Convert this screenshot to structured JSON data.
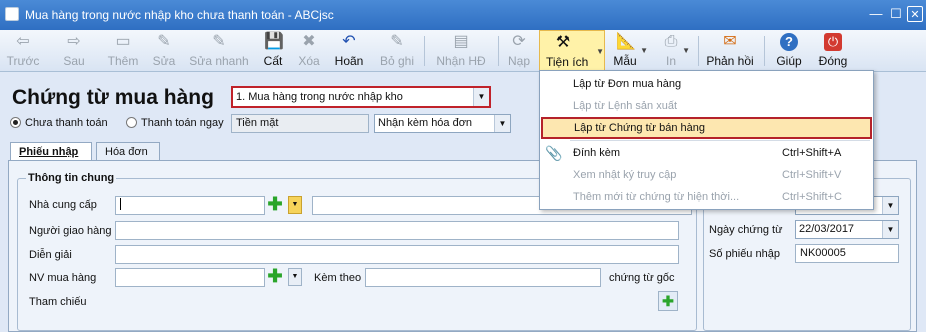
{
  "window": {
    "title": "Mua hàng trong nước nhập kho chưa thanh toán - ABCjsc",
    "min": "—",
    "max": "☐",
    "close": "✕"
  },
  "toolbar": [
    {
      "id": "truoc",
      "label": "Trước",
      "icon": "⇦",
      "disabled": true,
      "dd": true
    },
    {
      "id": "sau",
      "label": "Sau",
      "icon": "⇨",
      "disabled": true,
      "dd": true
    },
    {
      "id": "them",
      "label": "Thêm",
      "icon": "▭",
      "disabled": true
    },
    {
      "id": "sua",
      "label": "Sửa",
      "icon": "✎",
      "disabled": true
    },
    {
      "id": "suanhanh",
      "label": "Sửa nhanh",
      "icon": "✎",
      "disabled": true
    },
    {
      "id": "cat",
      "label": "Cất",
      "icon": "💾",
      "disabled": false
    },
    {
      "id": "xoa",
      "label": "Xóa",
      "icon": "✖",
      "disabled": true
    },
    {
      "id": "hoan",
      "label": "Hoãn",
      "icon": "↶",
      "disabled": false
    },
    {
      "id": "boghi",
      "label": "Bỏ ghi",
      "icon": "✎",
      "disabled": true
    },
    {
      "id": "nhanhd",
      "label": "Nhận HĐ",
      "icon": "▤",
      "disabled": true
    },
    {
      "id": "nap",
      "label": "Nạp",
      "icon": "⟳",
      "disabled": true
    },
    {
      "id": "tienich",
      "label": "Tiện ích",
      "icon": "⚒",
      "disabled": false,
      "active": true,
      "dd": true
    },
    {
      "id": "mau",
      "label": "Mẫu",
      "icon": "📐",
      "disabled": false,
      "dd": true
    },
    {
      "id": "in",
      "label": "In",
      "icon": "⎙",
      "disabled": true,
      "dd": true
    },
    {
      "id": "phanhoi",
      "label": "Phản hồi",
      "icon": "✉",
      "disabled": false
    },
    {
      "id": "giup",
      "label": "Giúp",
      "icon": "?",
      "disabled": false
    },
    {
      "id": "dong",
      "label": "Đóng",
      "icon": "⏻",
      "disabled": false
    }
  ],
  "form": {
    "title": "Chứng từ mua hàng",
    "doc_type": "1. Mua hàng trong nước nhập kho",
    "radio_unpaid": "Chưa thanh toán",
    "radio_paid": "Thanh toán ngay",
    "payment_method": "Tiền mặt",
    "invoice_option": "Nhận kèm hóa đơn"
  },
  "tabs": {
    "phieu_nhap": "Phiếu nhập",
    "hoa_don": "Hóa đơn"
  },
  "general": {
    "title": "Thông tin chung",
    "supplier": "Nhà cung cấp",
    "receiver": "Người giao hàng",
    "description": "Diễn giải",
    "buyer": "NV mua hàng",
    "attached": "Kèm theo",
    "attached_suffix": "chứng từ gốc",
    "reference": "Tham chiếu"
  },
  "doc": {
    "date_label": "Ngày chứng từ",
    "date_value": "22/03/2017",
    "no_label": "Số phiếu nhập",
    "no_value": "NK00005"
  },
  "menu": [
    {
      "label": "Lập từ Đơn mua hàng",
      "shortcut": "",
      "disabled": false
    },
    {
      "label": "Lập từ Lệnh sản xuất",
      "shortcut": "",
      "disabled": true
    },
    {
      "label": "Lập từ Chứng từ bán hàng",
      "shortcut": "",
      "disabled": false,
      "highlight": true
    },
    {
      "label": "Đính kèm",
      "shortcut": "Ctrl+Shift+A",
      "disabled": false,
      "icon": "📎"
    },
    {
      "label": "Xem nhật ký truy cập",
      "shortcut": "Ctrl+Shift+V",
      "disabled": true
    },
    {
      "label": "Thêm mới từ chứng từ hiện thời...",
      "shortcut": "Ctrl+Shift+C",
      "disabled": true
    }
  ],
  "colors": {
    "accent": "#2f6fc2",
    "highlight_border": "#c0222a",
    "active_tool": "#fff2a8"
  }
}
